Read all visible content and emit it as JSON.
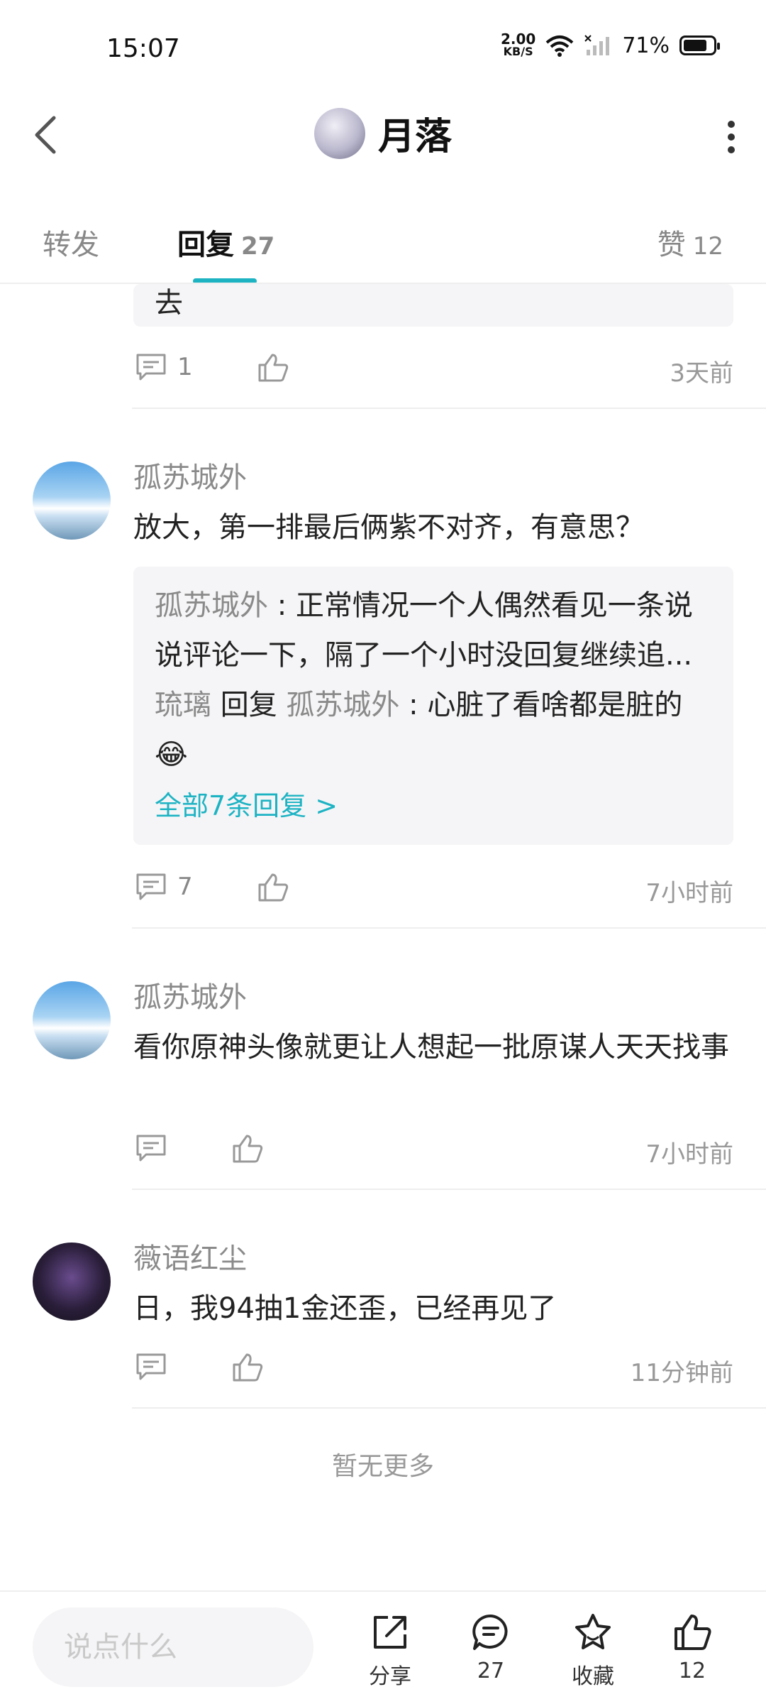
{
  "status_bar": {
    "time": "15:07",
    "net_speed_value": "2.00",
    "net_speed_unit": "KB/S",
    "battery": "71%"
  },
  "header": {
    "title": "月落"
  },
  "tabs": [
    {
      "label": "转发",
      "count": ""
    },
    {
      "label": "回复",
      "count": "27"
    },
    {
      "label": "赞",
      "count": "12"
    }
  ],
  "partial_comment": {
    "quote_tail": "去",
    "reply_count": "1",
    "time": "3天前"
  },
  "comments": [
    {
      "user": "孤苏城外",
      "text": "放大，第一排最后俩紫不对齐，有意思？",
      "replies": [
        {
          "who": "孤苏城外",
          "sep": ":",
          "text": "正常情况一个人偶然看见一条说说评论一下，隔了一个小时没回复继续追..."
        },
        {
          "who": "琉璃",
          "reply_word": "回复",
          "to": "孤苏城外",
          "sep": ":",
          "text": "心脏了看啥都是脏的😂"
        }
      ],
      "all_replies": "全部7条回复 >",
      "reply_count": "7",
      "time": "7小时前"
    },
    {
      "user": "孤苏城外",
      "text": "看你原神头像就更让人想起一批原谋人天天找事",
      "time": "7小时前"
    },
    {
      "user": "薇语红尘",
      "text": "日，我94抽1金还歪，已经再见了",
      "time": "11分钟前"
    }
  ],
  "no_more": "暂无更多",
  "bottom_bar": {
    "placeholder": "说点什么",
    "share": "分享",
    "comments_count": "27",
    "favorite": "收藏",
    "likes_count": "12"
  },
  "colors": {
    "accent": "#1db3c3",
    "muted": "#8a8a8a"
  }
}
